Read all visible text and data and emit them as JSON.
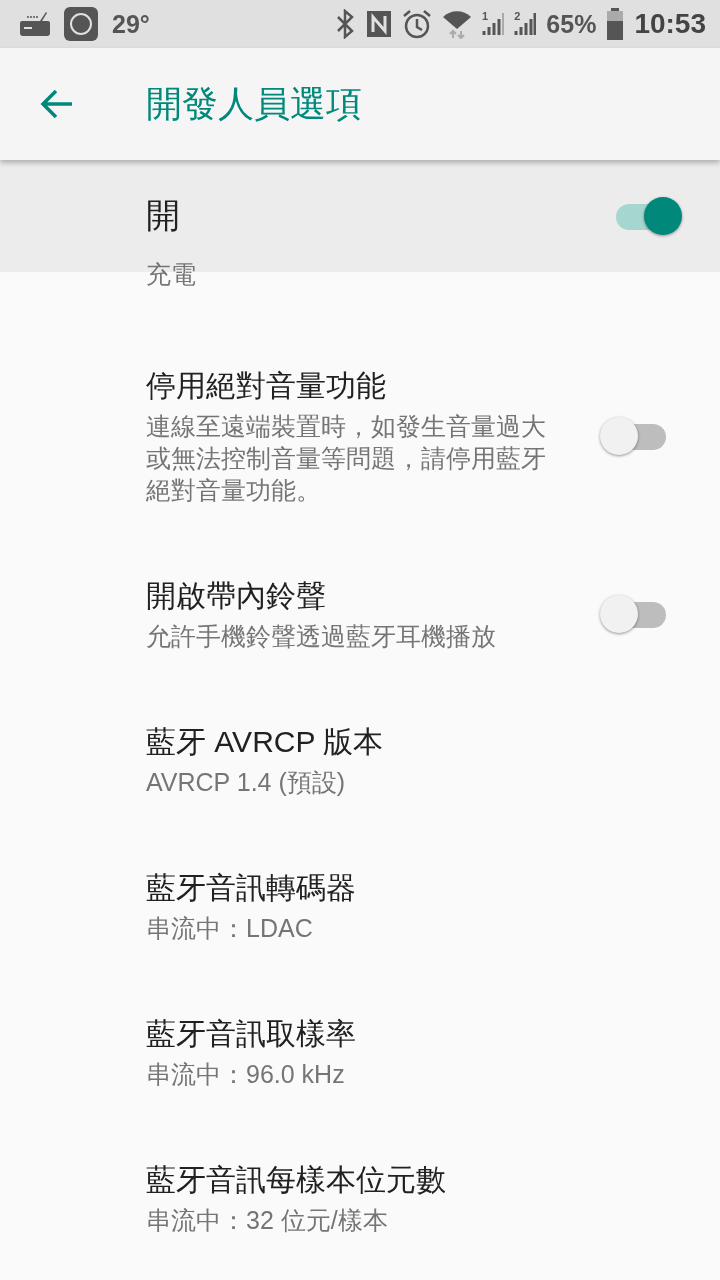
{
  "status_bar": {
    "temperature": "29°",
    "sim_1": "1",
    "sim_2": "2",
    "battery": "65%",
    "time": "10:53"
  },
  "toolbar": {
    "title": "開發人員選項"
  },
  "master_switch": {
    "label": "開",
    "on": true
  },
  "items": [
    {
      "kind": "text",
      "summary": "充電"
    },
    {
      "kind": "switch",
      "title": "停用絕對音量功能",
      "summary": "連線至遠端裝置時，如發生音量過大或無法控制音量等問題，請停用藍牙絕對音量功能。",
      "on": false
    },
    {
      "kind": "switch",
      "title": "開啟帶內鈴聲",
      "summary": "允許手機鈴聲透過藍牙耳機播放",
      "on": false
    },
    {
      "kind": "option",
      "title": "藍牙 AVRCP 版本",
      "summary": "AVRCP 1.4 (預設)"
    },
    {
      "kind": "option",
      "title": "藍牙音訊轉碼器",
      "summary": "串流中：LDAC"
    },
    {
      "kind": "option",
      "title": "藍牙音訊取樣率",
      "summary": "串流中：96.0 kHz"
    },
    {
      "kind": "option",
      "title": "藍牙音訊每樣本位元數",
      "summary": "串流中：32 位元/樣本"
    }
  ]
}
